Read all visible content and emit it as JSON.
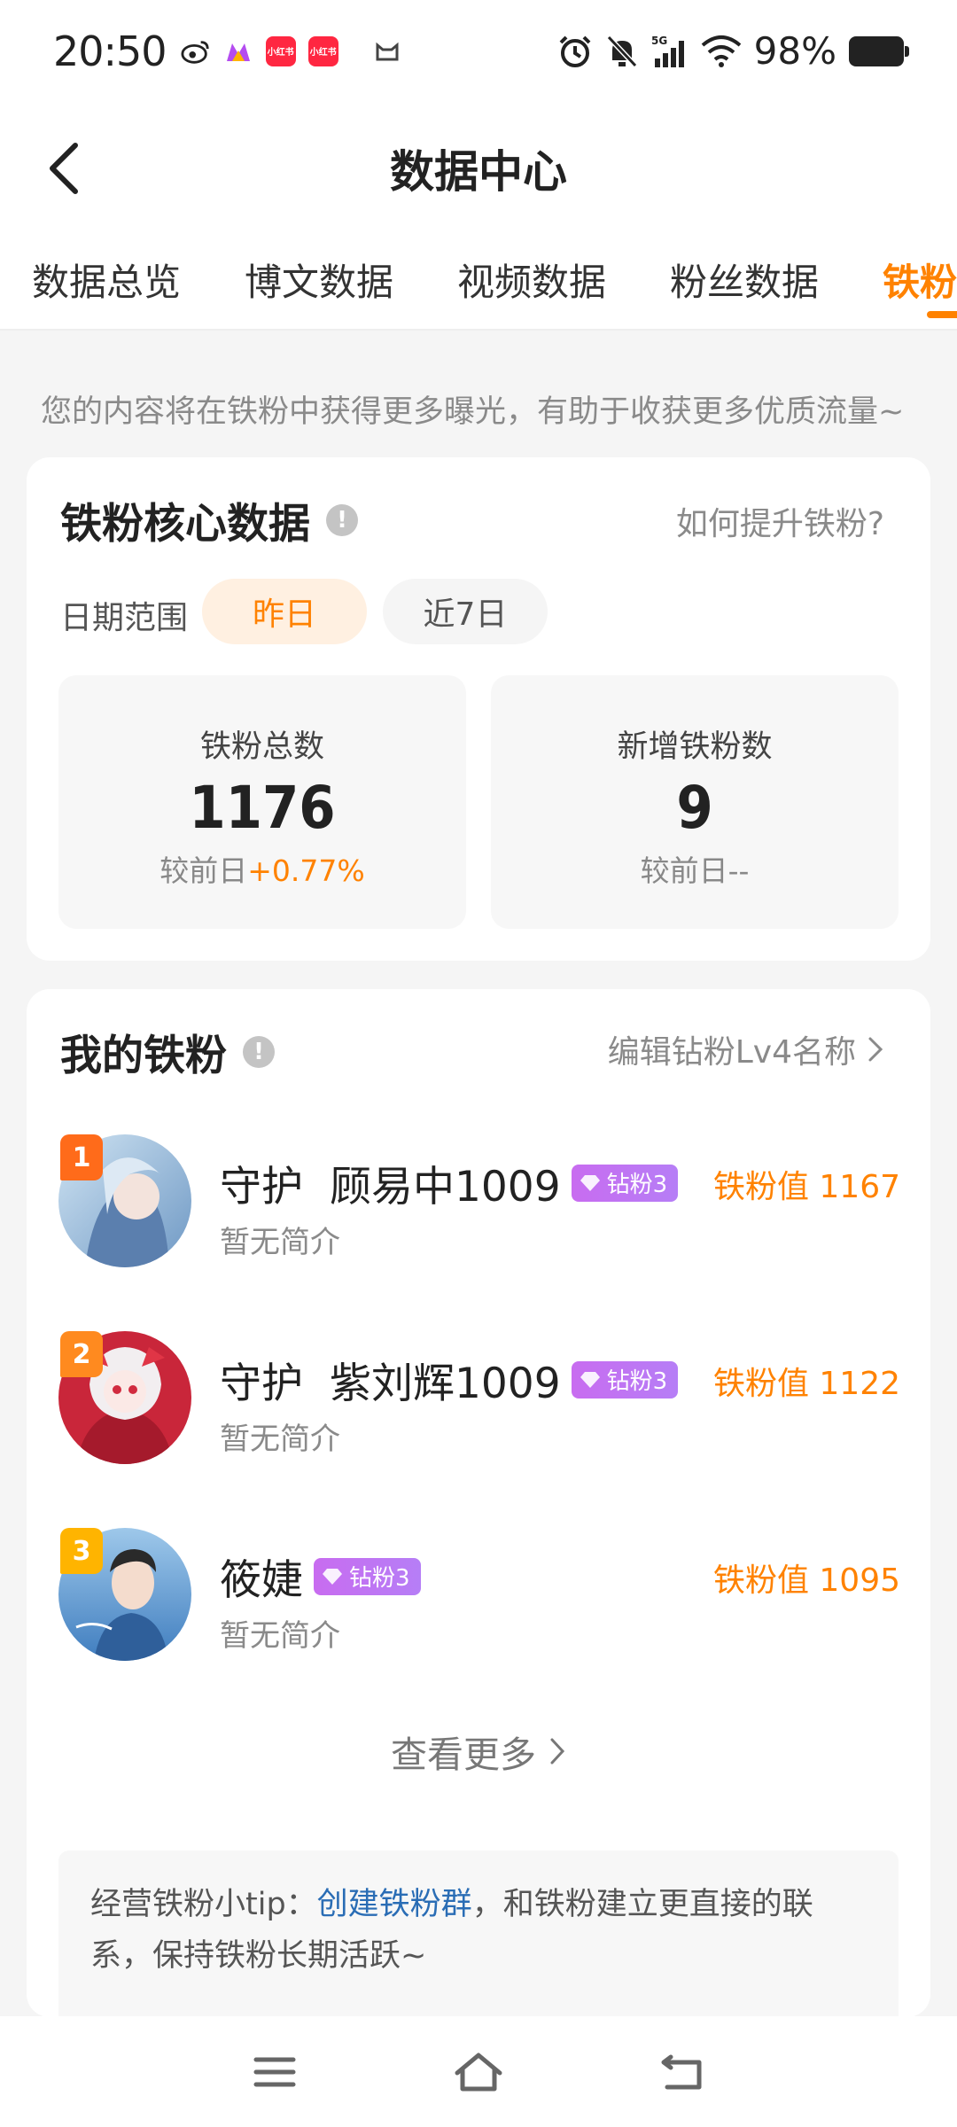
{
  "status_bar": {
    "time": "20:50",
    "battery": "98%",
    "apps": [
      {
        "icon": "weibo-icon",
        "color": "#222222",
        "label": ""
      },
      {
        "icon": "colorful-app-icon",
        "color": "#b44cf0",
        "label": ""
      },
      {
        "icon": "xiaohongshu-icon",
        "color": "#ff2741",
        "label": "小红书"
      },
      {
        "icon": "xiaohongshu-icon",
        "color": "#ff2741",
        "label": "小红书"
      },
      {
        "icon": "cat-app-icon",
        "color": "#444444",
        "label": ""
      }
    ]
  },
  "nav": {
    "title": "数据中心"
  },
  "tabs": [
    {
      "label": "数据总览",
      "active": false
    },
    {
      "label": "博文数据",
      "active": false
    },
    {
      "label": "视频数据",
      "active": false
    },
    {
      "label": "粉丝数据",
      "active": false
    },
    {
      "label": "铁粉",
      "active": true
    }
  ],
  "tip": "您的内容将在铁粉中获得更多曝光，有助于收获更多优质流量~",
  "core": {
    "title": "铁粉核心数据",
    "info_glyph": "!",
    "help_link": "如何提升铁粉?",
    "date_label": "日期范围",
    "ranges": [
      {
        "label": "昨日",
        "active": true
      },
      {
        "label": "近7日",
        "active": false
      }
    ],
    "stats": [
      {
        "label": "铁粉总数",
        "value": "1176",
        "change_prefix": "较前日",
        "change": "+0.77%"
      },
      {
        "label": "新增铁粉数",
        "value": "9",
        "change_prefix": "较前日",
        "change": "--"
      }
    ]
  },
  "my_fans": {
    "title": "我的铁粉",
    "info_glyph": "!",
    "edit_link": "编辑钻粉Lv4名称",
    "fans": [
      {
        "rank": "1",
        "name_prefix": "守护",
        "name": "顾易中1009",
        "tag": "钻粉3",
        "value": "铁粉值 1167",
        "intro": "暂无简介"
      },
      {
        "rank": "2",
        "name_prefix": "守护",
        "name": "紫刘辉1009",
        "tag": "钻粉3",
        "value": "铁粉值 1122",
        "intro": "暂无简介"
      },
      {
        "rank": "3",
        "name_prefix": "",
        "name": "筱婕",
        "tag": "钻粉3",
        "value": "铁粉值 1095",
        "intro": "暂无简介"
      }
    ],
    "view_more": "查看更多",
    "tip_prefix": "经营铁粉小tip：",
    "tip_link": "创建铁粉群",
    "tip_suffix": "，和铁粉建立更直接的联系，保持铁粉长期活跃~"
  },
  "colors": {
    "accent": "#ff8200",
    "tag": "#c86cf0",
    "link": "#2a6db5"
  }
}
